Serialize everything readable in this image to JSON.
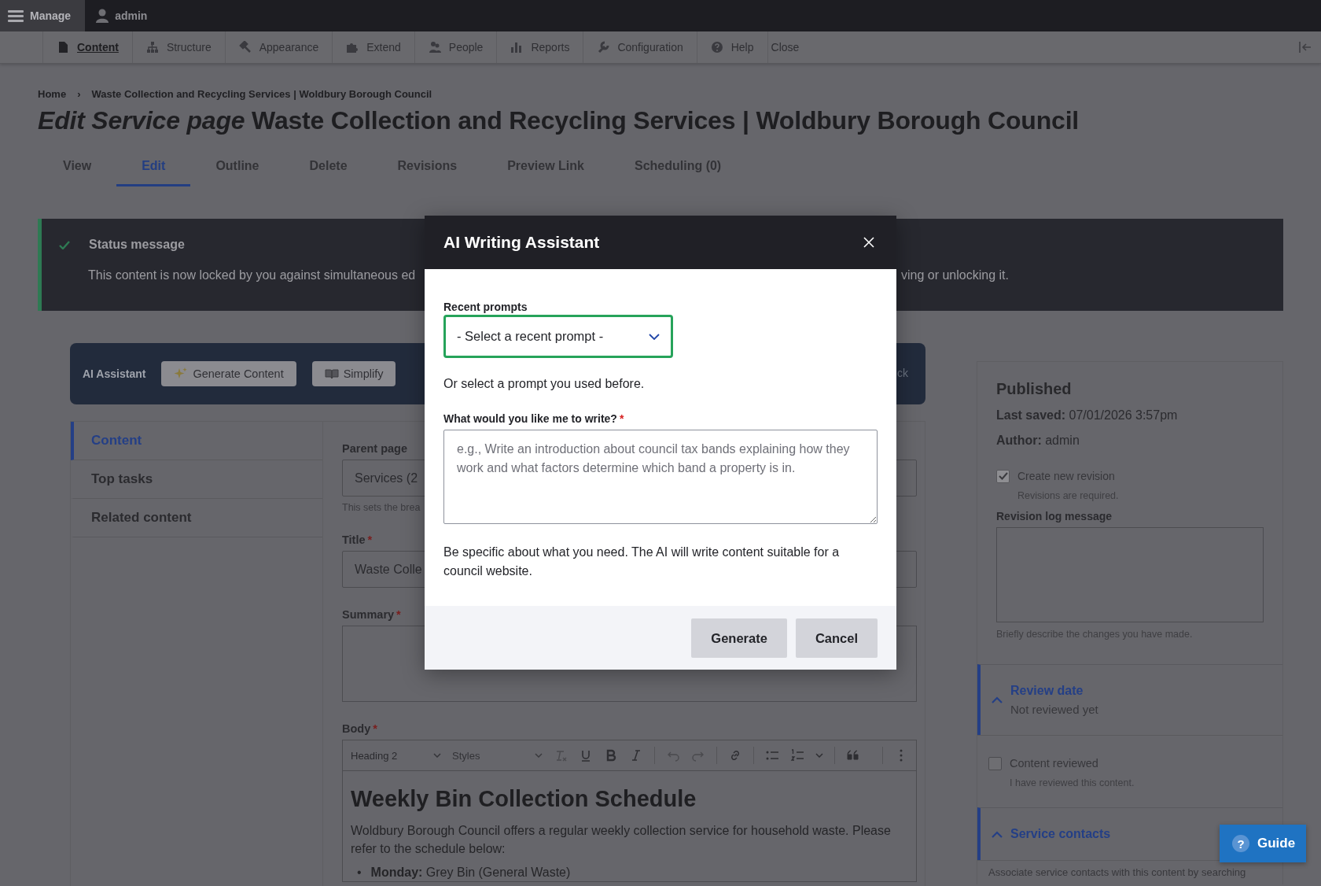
{
  "toolbar": {
    "manage": "Manage",
    "user": "admin"
  },
  "admin_menu": [
    {
      "label": "Content",
      "selected": true
    },
    {
      "label": "Structure",
      "selected": false
    },
    {
      "label": "Appearance",
      "selected": false
    },
    {
      "label": "Extend",
      "selected": false
    },
    {
      "label": "People",
      "selected": false
    },
    {
      "label": "Reports",
      "selected": false
    },
    {
      "label": "Configuration",
      "selected": false
    },
    {
      "label": "Help",
      "selected": false
    },
    {
      "label": "Close",
      "selected": false
    }
  ],
  "breadcrumb": {
    "items": [
      "Home",
      "Waste Collection and Recycling Services | Woldbury Borough Council"
    ],
    "separator": "›"
  },
  "page_title": "*Edit Service page* Waste Collection and Recycling Services | Woldbury Borough Council",
  "tabs": [
    {
      "label": "View",
      "selected": false
    },
    {
      "label": "Edit",
      "selected": true
    },
    {
      "label": "Outline",
      "selected": false
    },
    {
      "label": "Delete",
      "selected": false
    },
    {
      "label": "Revisions",
      "selected": false
    },
    {
      "label": "Preview Link",
      "selected": false
    },
    {
      "label": "Scheduling (0)",
      "selected": false
    }
  ],
  "status_message": {
    "title": "Status message",
    "text_before_dialog": "This content is now locked by you against simultaneous ed",
    "text_after_dialog": "ving or unlocking it."
  },
  "ai_toolbar": {
    "label": "AI Assistant",
    "buttons": [
      {
        "label": "Generate Content"
      },
      {
        "label": "Simplify"
      }
    ],
    "text_after_dialog": "ck"
  },
  "side_tabs": [
    {
      "label": "Content",
      "selected": true
    },
    {
      "label": "Top tasks",
      "selected": false
    },
    {
      "label": "Related content",
      "selected": false
    }
  ],
  "form": {
    "parent_page": {
      "label": "Parent page",
      "value": "Services (2",
      "help": "This sets the brea"
    },
    "title": {
      "label": "Title",
      "required_marker": "*",
      "value": "Waste Colle"
    },
    "summary": {
      "label": "Summary",
      "required_marker": "*"
    },
    "body": {
      "label": "Body",
      "required_marker": "*",
      "heading_select": "Heading 2",
      "styles_select": "Styles",
      "heading": "Weekly Bin Collection Schedule",
      "paragraph": "Woldbury Borough Council offers a regular weekly collection service for household waste. Please refer to the schedule below:",
      "list": [
        {
          "marker": "•",
          "text": "**Monday:** Grey Bin (General Waste)"
        }
      ]
    }
  },
  "sidebar": {
    "status": "Published",
    "last_saved": "**Last saved:** 07/01/2026 3:57pm",
    "author": "**Author:** admin",
    "create_revision": {
      "label": "Create new revision",
      "checked": true,
      "disabled": true,
      "help": "Revisions are required."
    },
    "revision_log": {
      "label": "Revision log message",
      "help": "Briefly describe the changes you have made."
    },
    "review_date": {
      "title": "Review date",
      "summary": "Not reviewed yet",
      "expanded": true
    },
    "content_reviewed": {
      "label": "Content reviewed",
      "checked": false,
      "disabled": false,
      "help": "I have reviewed this content."
    },
    "service_contacts": {
      "title": "Service contacts",
      "expanded": true,
      "description": "Associate service contacts with this content by searching"
    }
  },
  "dialog": {
    "title": "AI Writing Assistant",
    "recent_prompts": {
      "label": "Recent prompts",
      "value": "- Select a recent prompt -",
      "focused": true,
      "help": "Or select a prompt you used before."
    },
    "prompt": {
      "label": "What would you like me to write?",
      "required_marker": "*",
      "placeholder": "e.g., Write an introduction about council tax bands explaining how they work and what factors determine which band a property is in.",
      "help": "Be specific about what you need. The AI will write content suitable for a council website."
    },
    "buttons": [
      {
        "label": "Generate"
      },
      {
        "label": "Cancel"
      }
    ]
  },
  "guide_button": {
    "icon": "?",
    "label": "Guide"
  }
}
